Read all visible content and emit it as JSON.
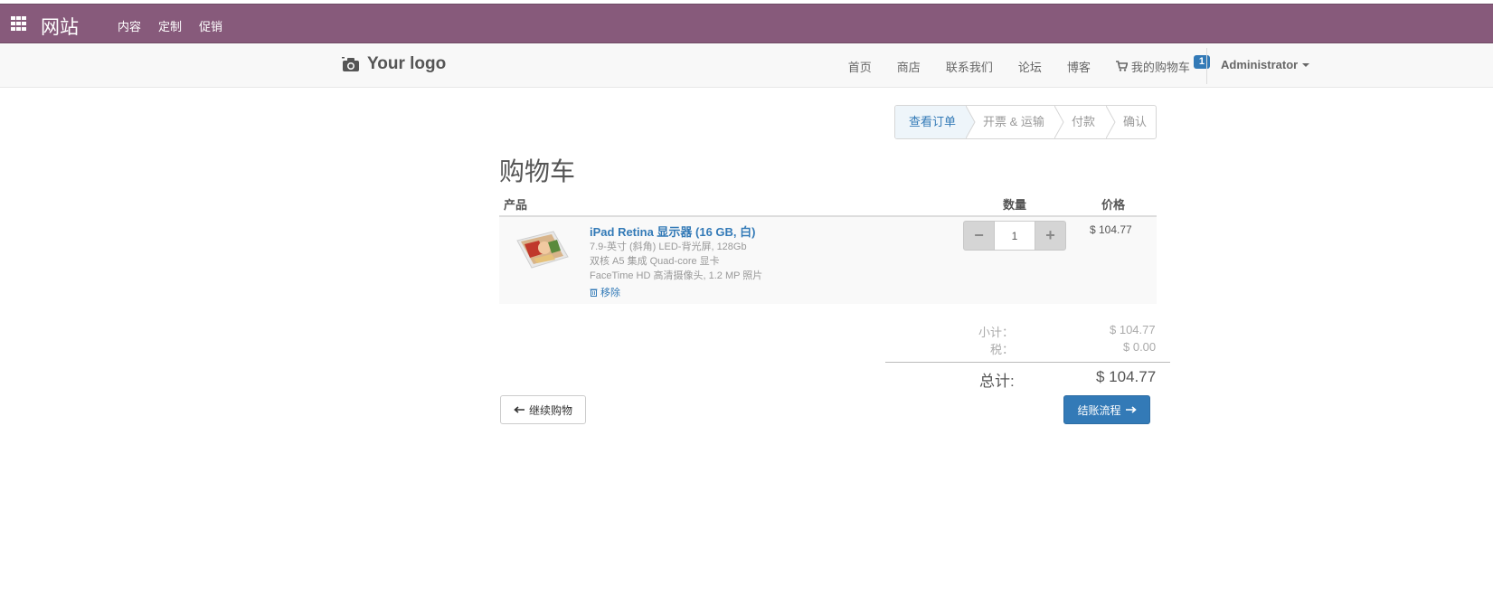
{
  "admin_bar": {
    "title": "网站",
    "menu": [
      "内容",
      "定制",
      "促销"
    ]
  },
  "site_nav": {
    "logo_text": "Your logo",
    "links": [
      "首页",
      "商店",
      "联系我们",
      "论坛",
      "博客"
    ],
    "cart_label": "我的购物车",
    "cart_count": "1",
    "user": "Administrator"
  },
  "wizard": {
    "steps": [
      "查看订单",
      "开票 & 运输",
      "付款",
      "确认"
    ],
    "active_index": 0
  },
  "cart": {
    "title": "购物车",
    "columns": {
      "product": "产品",
      "quantity": "数量",
      "price": "价格"
    },
    "items": [
      {
        "name": "iPad Retina 显示器 (16 GB, 白)",
        "description": [
          "7.9-英寸 (斜角) LED-背光屏, 128Gb",
          "双核 A5 集成 Quad-core 显卡",
          "FaceTime HD 高清摄像头, 1.2 MP 照片"
        ],
        "remove_label": "移除",
        "quantity": "1",
        "price": "$ 104.77"
      }
    ],
    "summary": {
      "subtotal_label": "小计：",
      "subtotal_value": "$ 104.77",
      "tax_label": "税：",
      "tax_value": "$ 0.00",
      "total_label": "总计:",
      "total_value": "$ 104.77"
    },
    "continue_label": "继续购物",
    "checkout_label": "结账流程"
  },
  "colors": {
    "admin_bar": "#875a7b",
    "primary": "#337ab7",
    "navbar_bg": "#f8f8f8"
  }
}
